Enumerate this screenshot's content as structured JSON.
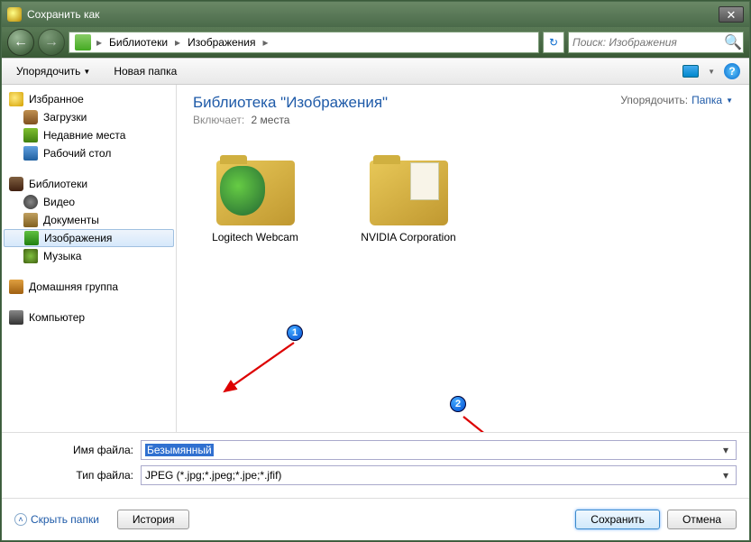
{
  "window": {
    "title": "Сохранить как"
  },
  "breadcrumb": {
    "seg1": "Библиотеки",
    "seg2": "Изображения"
  },
  "search": {
    "placeholder": "Поиск: Изображения"
  },
  "toolbar": {
    "organize": "Упорядочить",
    "newfolder": "Новая папка"
  },
  "sidebar": {
    "favorites": "Избранное",
    "downloads": "Загрузки",
    "recent": "Недавние места",
    "desktop": "Рабочий стол",
    "libraries": "Библиотеки",
    "video": "Видео",
    "documents": "Документы",
    "images": "Изображения",
    "music": "Музыка",
    "homegroup": "Домашняя группа",
    "computer": "Компьютер"
  },
  "content": {
    "title": "Библиотека \"Изображения\"",
    "subtitle_prefix": "Включает:",
    "subtitle_count": "2 места",
    "sort_label": "Упорядочить:",
    "sort_value": "Папка",
    "folder1": "Logitech Webcam",
    "folder2": "NVIDIA Corporation"
  },
  "form": {
    "name_label": "Имя файла:",
    "name_value": "Безымянный",
    "type_label": "Тип файла:",
    "type_value": "JPEG (*.jpg;*.jpeg;*.jpe;*.jfif)"
  },
  "footer": {
    "hide_folders": "Скрыть папки",
    "history": "История",
    "save": "Сохранить",
    "cancel": "Отмена"
  },
  "annotations": {
    "one": "1",
    "two": "2"
  }
}
